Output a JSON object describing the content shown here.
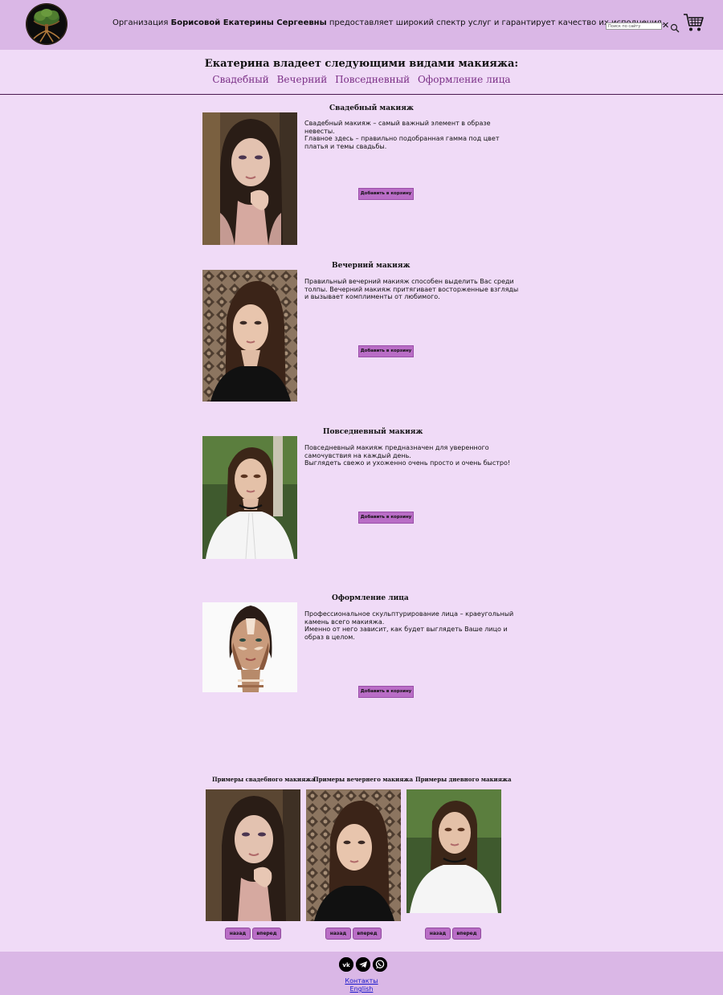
{
  "header": {
    "tagline_prefix": "Организация ",
    "tagline_name": "Борисовой Екатерины Сергеевны",
    "tagline_suffix": " предоставляет широкий спектр услуг и гарантирует качество их исполнения.",
    "search_placeholder": "Поиск по сайту",
    "clear_symbol": "✕"
  },
  "intro": {
    "title": "Екатерина владеет следующими видами макияжа:",
    "nav": [
      "Свадебный",
      "Вечерний",
      "Повседневный",
      "Оформление лица"
    ]
  },
  "services": [
    {
      "title": "Свадебный макияж",
      "lines": [
        "Свадебный макияж – самый важный элемент в образе невесты.",
        "Главное здесь – правильно подобранная гамма под цвет платья и темы свадьбы."
      ],
      "button": "Добавить в корзину"
    },
    {
      "title": "Вечерний макияж",
      "lines": [
        "Правильный вечерний макияж способен выделить Вас среди толпы. Вечерний макияж притягивает восторженные взгляды и вызывает комплименты от любимого."
      ],
      "button": "Добавить в корзину"
    },
    {
      "title": "Повседневный макияж",
      "lines": [
        "Повседневный макияж предназначен для уверенного самочувствия на каждый день.",
        "Выглядеть свежо и ухоженно очень просто и очень быстро!"
      ],
      "button": "Добавить в корзину"
    },
    {
      "title": "Оформление лица",
      "lines": [
        "Профессиональное скульптурирование лица – краеугольный камень всего макияжа.",
        "Именно от него зависит, как будет выглядеть Ваше лицо и образ в целом."
      ],
      "button": "Добавить в корзину"
    }
  ],
  "gallery": [
    {
      "title": "Примеры свадебного макияжа",
      "prev": "назад",
      "next": "вперед"
    },
    {
      "title": "Примеры вечернего макияжа",
      "prev": "назад",
      "next": "вперед"
    },
    {
      "title": "Примеры дневного макияжа",
      "prev": "назад",
      "next": "вперед"
    }
  ],
  "footer": {
    "social": [
      "vk-icon",
      "telegram-icon",
      "whatsapp-icon"
    ],
    "contacts": "Контакты",
    "language": "English"
  },
  "colors": {
    "page_bg": "#f0dbf7",
    "header_bg": "#dab7e6",
    "accent_button": "#b96dc6",
    "nav_link": "#7a2e86"
  }
}
